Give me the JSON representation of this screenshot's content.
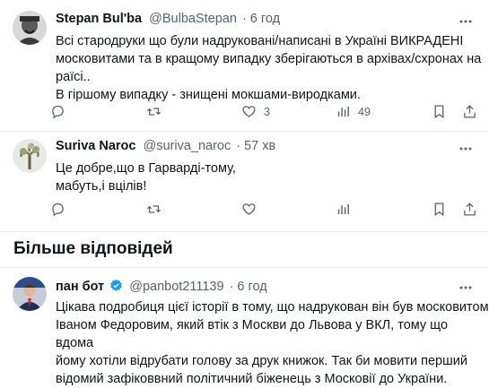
{
  "tweets": [
    {
      "name": "Stepan Bul'ba",
      "handle": "@BulbaStepan",
      "time": "· 6 год",
      "lines": [
        "Всі стародруки що були надруковані/написані в Україні ВИКРАДЕНІ",
        "московитами та в кращому випадку зберігаються в архівах/схронах на",
        "раїсі..",
        "В гіршому випадку - знищені мокшами-виродками."
      ],
      "actions": {
        "replies": "",
        "retweets": "",
        "likes": "3",
        "views": "49"
      }
    },
    {
      "name": "Suriva Naroc",
      "handle": "@suriva_naroc",
      "time": "· 57 хв",
      "lines": [
        "Це добре,що в Гарварді-тому,",
        "мабуть,і вцілів!"
      ],
      "actions": {
        "replies": "",
        "retweets": "",
        "likes": "",
        "views": ""
      }
    },
    {
      "name": "пан бот",
      "handle": "@panbot211139",
      "time": "· 6 год",
      "lines": [
        "Цікава подробиця цієї історії в тому, що надрукован він був московитом",
        "Іваном Федоровим, який втік з Москви до Львова у ВКЛ, тому що вдома",
        "йому хотіли відрубати голову за друк книжок. Так би мовити перший",
        "відомий зафіковвний  політичний біженець з Московії до України."
      ]
    }
  ],
  "section": {
    "more_replies": "Більше відповідей"
  },
  "colors": {
    "text": "#0f1419",
    "muted": "#536471",
    "divider": "#eff3f4",
    "verified": "#1d9bf0"
  }
}
